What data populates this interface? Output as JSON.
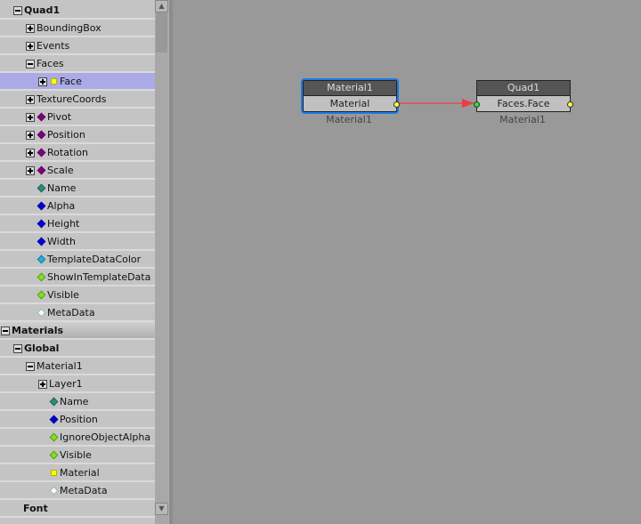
{
  "tree": [
    {
      "label": "Quad1",
      "level": 1,
      "exp": "minus",
      "bold": true
    },
    {
      "label": "BoundingBox",
      "level": 2,
      "exp": "plus"
    },
    {
      "label": "Events",
      "level": 2,
      "exp": "plus"
    },
    {
      "label": "Faces",
      "level": 2,
      "exp": "minus"
    },
    {
      "label": "Face",
      "level": 3,
      "exp": "plus",
      "bullet": "#ffff00",
      "square": true,
      "selected": true
    },
    {
      "label": "TextureCoords",
      "level": 2,
      "exp": "plus"
    },
    {
      "label": "Pivot",
      "level": 2,
      "exp": "plus",
      "bullet": "#800080"
    },
    {
      "label": "Position",
      "level": 2,
      "exp": "plus",
      "bullet": "#800080"
    },
    {
      "label": "Rotation",
      "level": 2,
      "exp": "plus",
      "bullet": "#800080"
    },
    {
      "label": "Scale",
      "level": 2,
      "exp": "plus",
      "bullet": "#800080"
    },
    {
      "label": "Name",
      "level": 2,
      "exp": "none",
      "bullet": "#2e8b7a"
    },
    {
      "label": "Alpha",
      "level": 2,
      "exp": "none",
      "bullet": "#0000dd"
    },
    {
      "label": "Height",
      "level": 2,
      "exp": "none",
      "bullet": "#0000dd"
    },
    {
      "label": "Width",
      "level": 2,
      "exp": "none",
      "bullet": "#0000dd"
    },
    {
      "label": "TemplateDataColor",
      "level": 2,
      "exp": "none",
      "bullet": "#20b0e0"
    },
    {
      "label": "ShowInTemplateData",
      "level": 2,
      "exp": "none",
      "bullet": "#80e020"
    },
    {
      "label": "Visible",
      "level": 2,
      "exp": "none",
      "bullet": "#80e020"
    },
    {
      "label": "MetaData",
      "level": 2,
      "exp": "none",
      "bullet": "#f0ffff"
    },
    {
      "label": "Materials",
      "level": 0,
      "exp": "minus",
      "bold": true,
      "header": true
    },
    {
      "label": "Global",
      "level": 1,
      "exp": "minus",
      "bold": true
    },
    {
      "label": "Material1",
      "level": 2,
      "exp": "minus"
    },
    {
      "label": "Layer1",
      "level": 3,
      "exp": "plus"
    },
    {
      "label": "Name",
      "level": 3,
      "exp": "none",
      "bullet": "#2e8b7a"
    },
    {
      "label": "Position",
      "level": 3,
      "exp": "none",
      "bullet": "#0000dd"
    },
    {
      "label": "IgnoreObjectAlpha",
      "level": 3,
      "exp": "none",
      "bullet": "#80e020"
    },
    {
      "label": "Visible",
      "level": 3,
      "exp": "none",
      "bullet": "#80e020"
    },
    {
      "label": "Material",
      "level": 3,
      "exp": "none",
      "bullet": "#ffff00",
      "square": true
    },
    {
      "label": "MetaData",
      "level": 3,
      "exp": "none",
      "bullet": "#f0ffff"
    },
    {
      "label": "Font",
      "level": 1,
      "exp": "none",
      "bold": true
    }
  ],
  "nodes": {
    "material": {
      "title": "Material1",
      "port": "Material",
      "caption": "Material1"
    },
    "quad": {
      "title": "Quad1",
      "port": "Faces.Face",
      "caption": "Material1"
    }
  },
  "colors": {
    "link": "#e84040",
    "selection": "#1e7be6"
  }
}
